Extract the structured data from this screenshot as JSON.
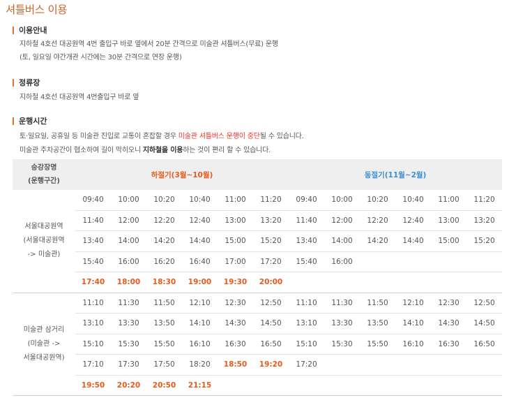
{
  "title": "셔틀버스 이용",
  "sections": {
    "guide": {
      "heading": "이용안내",
      "line1": "지하철 4호선 대공원역 4번 출입구 바로 옆에서 20분 간격으로 미술관 셔틀버스(무료) 운행",
      "line2": "(토, 일요일 야간개관 시간에는 30분 간격으로 연장 운행)"
    },
    "stop": {
      "heading": "정류장",
      "line1": "지하철 4호선 대공원역 4번출입구 바로 옆"
    },
    "hours": {
      "heading": "운행시간",
      "line1_pre": "토·일요일, 공휴일 등 미술관 진입로 교통이 혼잡할 경우 ",
      "line1_red": "미술관 셔틀버스 운행이 중단",
      "line1_post": "될 수 있습니다.",
      "line2_pre": "미술관 주차공간이 협소하여 길이 막히오니 ",
      "line2_bold": "지하철을 이용",
      "line2_post": "하는 것이 편리 할 수 있습니다."
    }
  },
  "schedule": {
    "col_station_line1": "승강장명",
    "col_station_line2": "(운행구간)",
    "summer_label": "하절기(3월~10월)",
    "winter_label": "동절기(11월~2월)",
    "group1": {
      "station_line1": "서울대공원역",
      "station_line2": "(서울대공원역",
      "station_line3": "-> 미술관)",
      "rows": [
        [
          "09:40",
          "10:00",
          "10:20",
          "10:40",
          "11:00",
          "11:20",
          "09:40",
          "10:00",
          "10:20",
          "10:40",
          "11:00",
          "11:20"
        ],
        [
          "11:40",
          "12:00",
          "12:20",
          "12:40",
          "13:00",
          "13:20",
          "11:40",
          "12:00",
          "12:20",
          "12:40",
          "13:00",
          "13:20"
        ],
        [
          "13:40",
          "14:00",
          "14:20",
          "14:40",
          "15:00",
          "15:20",
          "13:40",
          "14:00",
          "14:20",
          "14:40",
          "15:00",
          "15:20"
        ],
        [
          "15:40",
          "16:00",
          "16:20",
          "16:40",
          "17:00",
          "17:20",
          "15:40",
          "16:00",
          "",
          "",
          "",
          ""
        ],
        [
          "17:40",
          "18:00",
          "18:30",
          "19:00",
          "19:30",
          "20:00",
          "",
          "",
          "",
          "",
          "",
          ""
        ]
      ]
    },
    "group2": {
      "station_line1": "미술관 삼거리",
      "station_line2": "(미술관 ->",
      "station_line3": "서울대공원역)",
      "rows": [
        [
          "11:10",
          "11:30",
          "11:50",
          "12:10",
          "12:30",
          "12:50",
          "11:10",
          "11:30",
          "11:50",
          "12:10",
          "12:30",
          "12:50"
        ],
        [
          "13:10",
          "13:30",
          "13:50",
          "14:10",
          "14:30",
          "14:50",
          "13:10",
          "13:30",
          "13:50",
          "14:10",
          "14:30",
          "14:50"
        ],
        [
          "15:10",
          "15:30",
          "15:50",
          "16:10",
          "16:30",
          "16:50",
          "15:10",
          "15:30",
          "15:50",
          "16:10",
          "16:30",
          "16:50"
        ],
        [
          "17:10",
          "17:30",
          "17:50",
          "18:20",
          "18:50",
          "19:20",
          "17:20",
          "",
          "",
          "",
          "",
          ""
        ],
        [
          "19:50",
          "20:20",
          "20:50",
          "21:15",
          "",
          "",
          "",
          "",
          "",
          "",
          "",
          ""
        ]
      ]
    },
    "highlight_color": "#e55b1b"
  }
}
